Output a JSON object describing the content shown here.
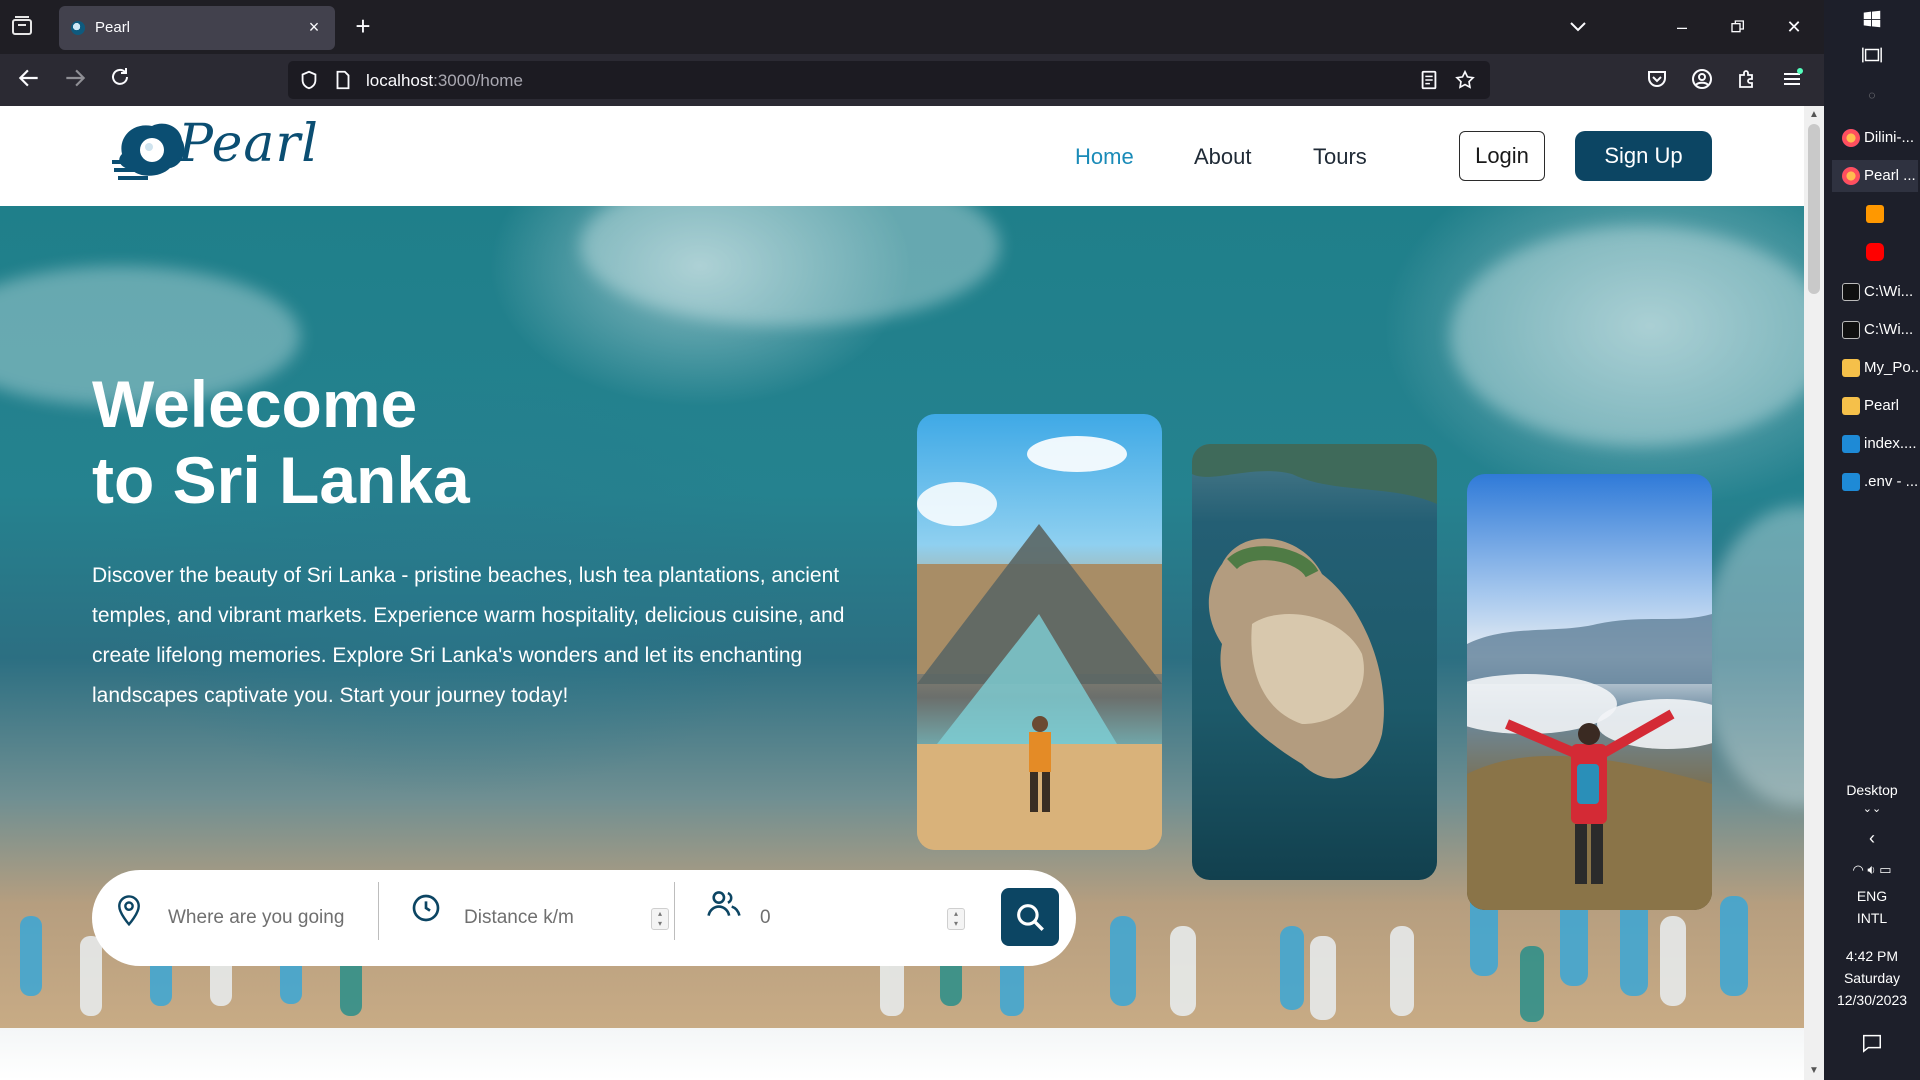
{
  "browser": {
    "tab_title": "Pearl",
    "url_host": "localhost",
    "url_rest": ":3000/home"
  },
  "site": {
    "brand": "Pearl",
    "nav": [
      "Home",
      "About",
      "Tours"
    ],
    "login": "Login",
    "signup": "Sign Up",
    "colors": {
      "primary": "#0c4563",
      "active_link": "#1a8bb8"
    }
  },
  "hero": {
    "title_line1": "Welecome",
    "title_line2": "to Sri Lanka",
    "description": "Discover the beauty of Sri Lanka - pristine beaches, lush tea plantations, ancient temples, and vibrant markets. Experience warm hospitality, delicious cuisine, and create lifelong memories. Explore Sri Lanka's wonders and let its enchanting landscapes captivate you. Start your journey today!"
  },
  "search": {
    "location_placeholder": "Where are you going",
    "distance_placeholder": "Distance k/m",
    "people_placeholder": "0"
  },
  "taskbar": {
    "items": [
      {
        "label": "Dilini-...",
        "icon": "firefox-icon"
      },
      {
        "label": "Pearl ...",
        "icon": "firefox-icon"
      },
      {
        "label": "",
        "icon": "sublime-icon"
      },
      {
        "label": "",
        "icon": "youtube-icon"
      },
      {
        "label": "C:\\Wi...",
        "icon": "cmd-icon"
      },
      {
        "label": "C:\\Wi...",
        "icon": "cmd-icon"
      },
      {
        "label": "My_Po...",
        "icon": "folder-icon"
      },
      {
        "label": "Pearl",
        "icon": "folder-icon"
      },
      {
        "label": "index....",
        "icon": "vscode-icon"
      },
      {
        "label": ".env - ...",
        "icon": "vscode-icon"
      }
    ],
    "desktop": "Desktop",
    "lang1": "ENG",
    "lang2": "INTL",
    "time": "4:42 PM",
    "day": "Saturday",
    "date": "12/30/2023"
  }
}
